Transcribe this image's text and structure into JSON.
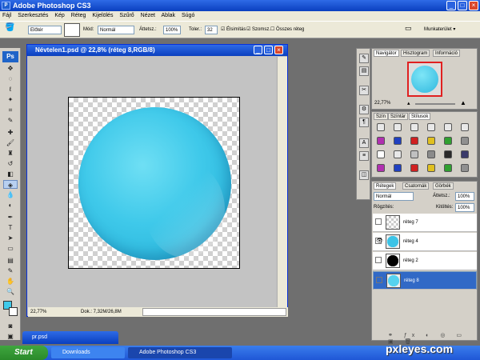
{
  "app": {
    "title": "Adobe Photoshop CS3",
    "logo": "Ps"
  },
  "menu": [
    "Fájl",
    "Szerkesztés",
    "Kép",
    "Réteg",
    "Kijelölés",
    "Szűrő",
    "Nézet",
    "Ablak",
    "Súgó"
  ],
  "options": {
    "preset": "Előtér",
    "mode_label": "Mód:",
    "mode_value": "Normál",
    "opacity_label": "Áttetsz.:",
    "opacity_value": "100%",
    "tolerance_label": "Toler.:",
    "tolerance_value": "32",
    "antialias": "Élsimítás",
    "contiguous": "Szomsz.",
    "all_layers": "Összes réteg",
    "workspace": "Munkaterület"
  },
  "document": {
    "title": "Névtelen1.psd @ 22,8% (réteg 8,RGB/8)",
    "zoom": "22,77%",
    "doc_info": "Dok.: 7,32M/26,8M"
  },
  "navigator": {
    "tabs": [
      "Navigátor",
      "Hisztogram",
      "Információ"
    ],
    "zoom": "22,77%"
  },
  "styles_panel": {
    "tabs": [
      "Szín",
      "Színtár",
      "Stílusok"
    ]
  },
  "layers_panel": {
    "tabs": [
      "Rétegek",
      "Csatornák",
      "Görbék"
    ],
    "blend": "Normál",
    "opacity_label": "Áttetsz.:",
    "opacity": "100%",
    "lock_label": "Rögzítés:",
    "fill_label": "Kitöltés:",
    "fill": "100%",
    "layers": [
      {
        "name": "réteg 7",
        "visible": false,
        "selected": false,
        "thumb": "transparent"
      },
      {
        "name": "réteg 4",
        "visible": true,
        "selected": false,
        "thumb": "#3cc3e6"
      },
      {
        "name": "réteg 2",
        "visible": false,
        "selected": false,
        "thumb": "#000000"
      },
      {
        "name": "réteg 8",
        "visible": false,
        "selected": true,
        "thumb": "#56d2ef"
      }
    ]
  },
  "minidoc": {
    "title": "pr.psd"
  },
  "taskbar": {
    "start": "Start",
    "tasks": [
      "Downloads",
      "Adobe Photoshop CS3"
    ]
  },
  "watermark": "pxleyes.com",
  "colors": {
    "ball": "#3fc9ea",
    "accent": "#0a3fbf"
  }
}
